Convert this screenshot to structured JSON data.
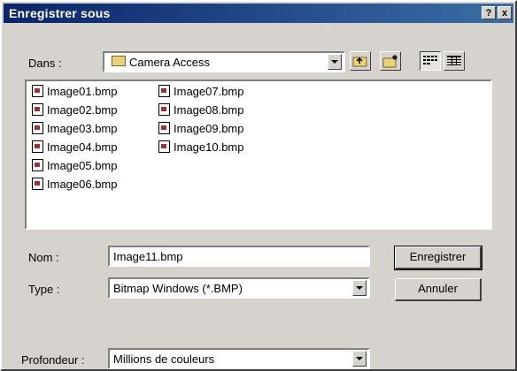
{
  "window": {
    "title": "Enregistrer sous",
    "help_label": "?",
    "close_label": "x"
  },
  "location": {
    "label": "Dans :",
    "value": "Camera Access"
  },
  "toolbar": {
    "up_icon": "up-folder-icon",
    "new_folder_icon": "new-folder-icon",
    "list_view_icon": "list-view-icon",
    "details_view_icon": "details-view-icon"
  },
  "files": [
    "Image01.bmp",
    "Image02.bmp",
    "Image03.bmp",
    "Image04.bmp",
    "Image05.bmp",
    "Image06.bmp",
    "Image07.bmp",
    "Image08.bmp",
    "Image09.bmp",
    "Image10.bmp"
  ],
  "filename": {
    "label": "Nom :",
    "value": "Image11.bmp"
  },
  "filetype": {
    "label": "Type :",
    "value": "Bitmap Windows (*.BMP)"
  },
  "depth": {
    "label": "Profondeur :",
    "value": "Millions de couleurs"
  },
  "buttons": {
    "save": "Enregistrer",
    "cancel": "Annuler"
  }
}
